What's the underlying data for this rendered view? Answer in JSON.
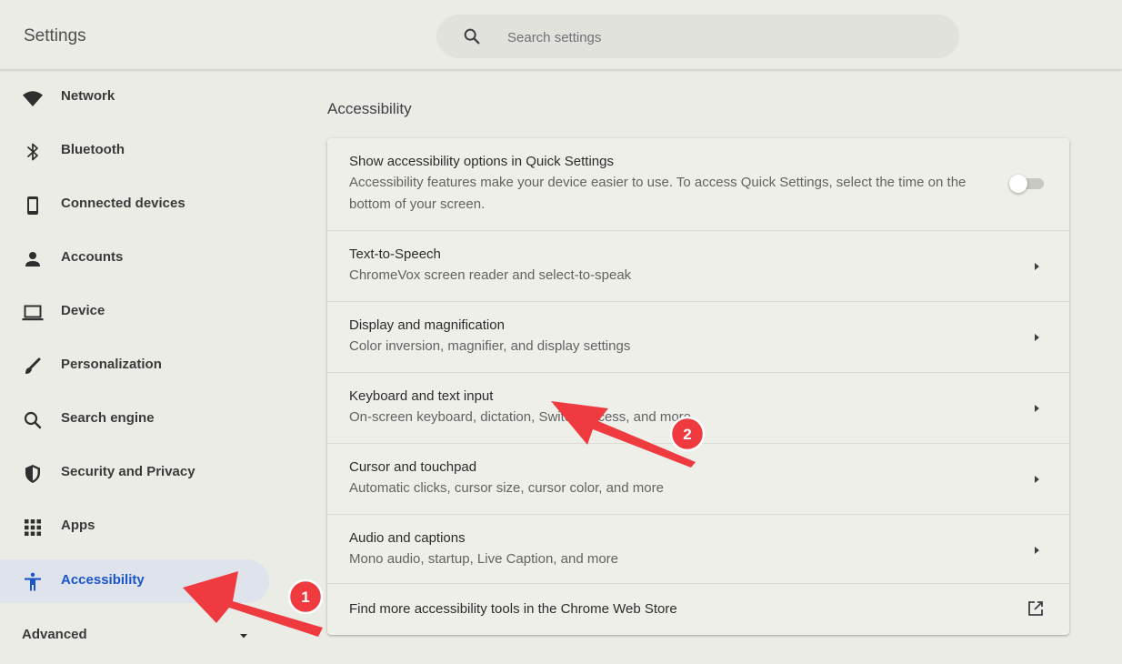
{
  "app": {
    "title": "Settings"
  },
  "search": {
    "placeholder": "Search settings",
    "icon": "search-icon"
  },
  "sidebar": {
    "items": [
      {
        "label": "Network",
        "icon": "wifi-icon"
      },
      {
        "label": "Bluetooth",
        "icon": "bluetooth-icon"
      },
      {
        "label": "Connected devices",
        "icon": "phone-icon"
      },
      {
        "label": "Accounts",
        "icon": "person-icon"
      },
      {
        "label": "Device",
        "icon": "laptop-icon"
      },
      {
        "label": "Personalization",
        "icon": "brush-icon"
      },
      {
        "label": "Search engine",
        "icon": "search-icon"
      },
      {
        "label": "Security and Privacy",
        "icon": "shield-icon"
      },
      {
        "label": "Apps",
        "icon": "apps-grid-icon"
      },
      {
        "label": "Accessibility",
        "icon": "accessibility-icon",
        "selected": true
      }
    ],
    "advanced": {
      "label": "Advanced"
    }
  },
  "main": {
    "section_title": "Accessibility",
    "quick_settings": {
      "title": "Show accessibility options in Quick Settings",
      "subtitle_line1": "Accessibility features make your device easier to use. To access Quick Settings, select the time on the",
      "subtitle_line2": "bottom of your screen.",
      "toggle_on": false
    },
    "rows": [
      {
        "title": "Text-to-Speech",
        "subtitle": "ChromeVox screen reader and select-to-speak"
      },
      {
        "title": "Display and magnification",
        "subtitle": "Color inversion, magnifier, and display settings"
      },
      {
        "title": "Keyboard and text input",
        "subtitle": "On-screen keyboard, dictation, Switch Access, and more"
      },
      {
        "title": "Cursor and touchpad",
        "subtitle": "Automatic clicks, cursor size, cursor color, and more"
      },
      {
        "title": "Audio and captions",
        "subtitle": "Mono audio, startup, Live Caption, and more"
      }
    ],
    "web_store": {
      "title": "Find more accessibility tools in the Chrome Web Store",
      "icon": "open-in-new-icon"
    }
  },
  "annotations": [
    {
      "number": "1"
    },
    {
      "number": "2"
    }
  ],
  "colors": {
    "accent": "#1a56c8",
    "annotation": "#ef3b40",
    "selected_bg": "#dfe3ec"
  }
}
